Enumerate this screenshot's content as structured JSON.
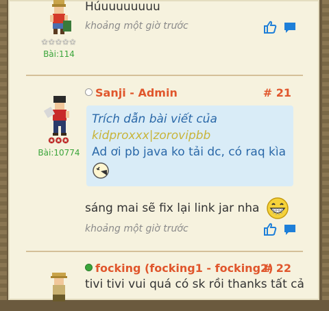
{
  "colors": {
    "background_page": "#f6f2de",
    "username": "#e0562c",
    "post_count": "#3aa53a",
    "quote_bg": "#d9ecf7",
    "quote_text": "#2a68a8",
    "quote_author": "#c8b43a",
    "icon_blue": "#1e7fd8"
  },
  "posts": [
    {
      "message": "Húuuuuuuuu",
      "time": "khoảng một giờ trước",
      "stars": "✩✩✩✩✩",
      "post_count": "Bài:114",
      "icons": [
        "thumbs-up-icon",
        "comment-icon"
      ]
    },
    {
      "username": "Sanji - Admin",
      "status": "offline",
      "post_number": "# 21",
      "quote": {
        "title": "Trích dẫn bài viết của",
        "author": "kidproxxx|zorovipbb",
        "text": "Ad ơi pb java ko tải dc, có raq kìa"
      },
      "message": "sáng mai sẽ fix lại link jar nha",
      "time": "khoảng một giờ trước",
      "stars": "✪✪✪",
      "post_count": "Bài:10774",
      "icons": [
        "thumbs-up-icon",
        "comment-icon"
      ]
    },
    {
      "username": "focking (focking1 - focking2)",
      "status": "online",
      "post_number": "# 22",
      "message": "tivi tivi vui quá có sk rồi thanks tất cả"
    }
  ]
}
